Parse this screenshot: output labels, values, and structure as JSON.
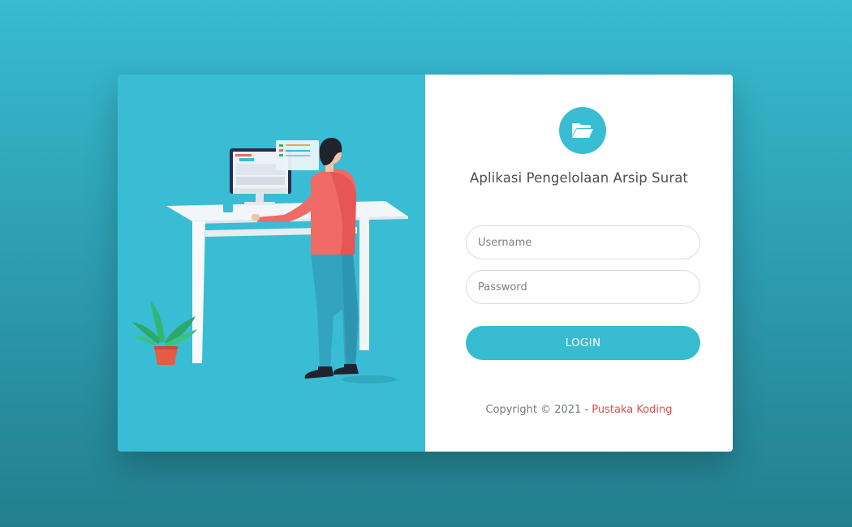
{
  "app": {
    "title": "Aplikasi Pengelolaan Arsip Surat",
    "logo_icon": "folder-open-icon"
  },
  "form": {
    "username_placeholder": "Username",
    "username_value": "",
    "password_placeholder": "Password",
    "password_value": "",
    "login_label": "LOGIN"
  },
  "footer": {
    "copyright_prefix": "Copyright © 2021 - ",
    "brand_link": "Pustaka Koding"
  },
  "colors": {
    "accent": "#39bdd5",
    "brand_link": "#e24c4b",
    "background_top": "#37bcd0",
    "background_bottom": "#237f8d"
  }
}
